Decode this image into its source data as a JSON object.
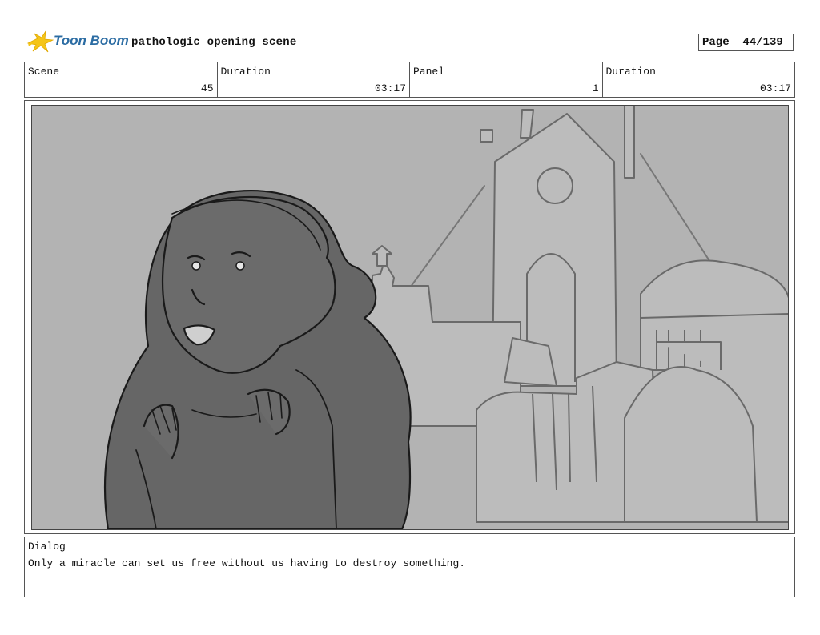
{
  "header": {
    "brand": "Toon Boom",
    "title": "pathologic opening scene",
    "page_label": "Page",
    "page_value": "44/139"
  },
  "info": {
    "scene_label": "Scene",
    "scene_value": "45",
    "duration_label": "Duration",
    "duration_value": "03:17",
    "panel_label": "Panel",
    "panel_value": "1",
    "panel_duration_label": "Duration",
    "panel_duration_value": "03:17"
  },
  "dialog": {
    "label": "Dialog",
    "text": "Only a miracle can set us free without us having to destroy something."
  },
  "colors": {
    "brand_blue": "#2b6ca3",
    "brand_yellow": "#f5c518",
    "panel_bg": "#b3b3b3",
    "figure_fill": "#666666",
    "building_fill": "#bcbcbc"
  },
  "icons": {
    "logo": "toon-boom-logo-icon"
  }
}
